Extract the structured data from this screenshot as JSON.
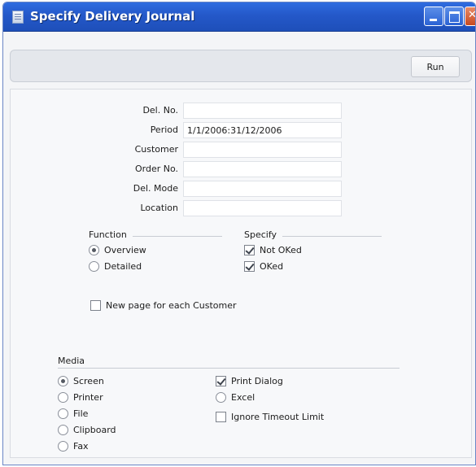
{
  "window": {
    "title": "Specify Delivery Journal",
    "icon": "document-icon",
    "controls": [
      "minimize-icon",
      "maximize-icon",
      "close-icon"
    ]
  },
  "toolbar": {
    "run_label": "Run"
  },
  "fields": [
    {
      "label": "Del. No.",
      "value": ""
    },
    {
      "label": "Period",
      "value": "1/1/2006:31/12/2006"
    },
    {
      "label": "Customer",
      "value": ""
    },
    {
      "label": "Order No.",
      "value": ""
    },
    {
      "label": "Del. Mode",
      "value": ""
    },
    {
      "label": "Location",
      "value": ""
    }
  ],
  "function": {
    "label": "Function",
    "options": [
      {
        "label": "Overview",
        "selected": true
      },
      {
        "label": "Detailed",
        "selected": false
      }
    ]
  },
  "specify": {
    "label": "Specify",
    "options": [
      {
        "label": "Not OKed",
        "checked": true
      },
      {
        "label": "OKed",
        "checked": true
      }
    ]
  },
  "new_page": {
    "label": "New page for each Customer",
    "checked": false
  },
  "media": {
    "label": "Media",
    "options": [
      {
        "label": "Screen",
        "selected": true
      },
      {
        "label": "Printer",
        "selected": false
      },
      {
        "label": "File",
        "selected": false
      },
      {
        "label": "Clipboard",
        "selected": false
      },
      {
        "label": "Fax",
        "selected": false
      }
    ]
  },
  "print_options": [
    {
      "label": "Print Dialog",
      "kind": "checkbox",
      "checked": true
    },
    {
      "label": "Excel",
      "kind": "radio",
      "selected": false
    },
    {
      "label": "Ignore Timeout Limit",
      "kind": "checkbox",
      "checked": false
    }
  ],
  "colors": {
    "titlebar": "#2458c9",
    "window_bg": "#f4f5f7",
    "toolbar_bg": "#e4e7ec"
  }
}
